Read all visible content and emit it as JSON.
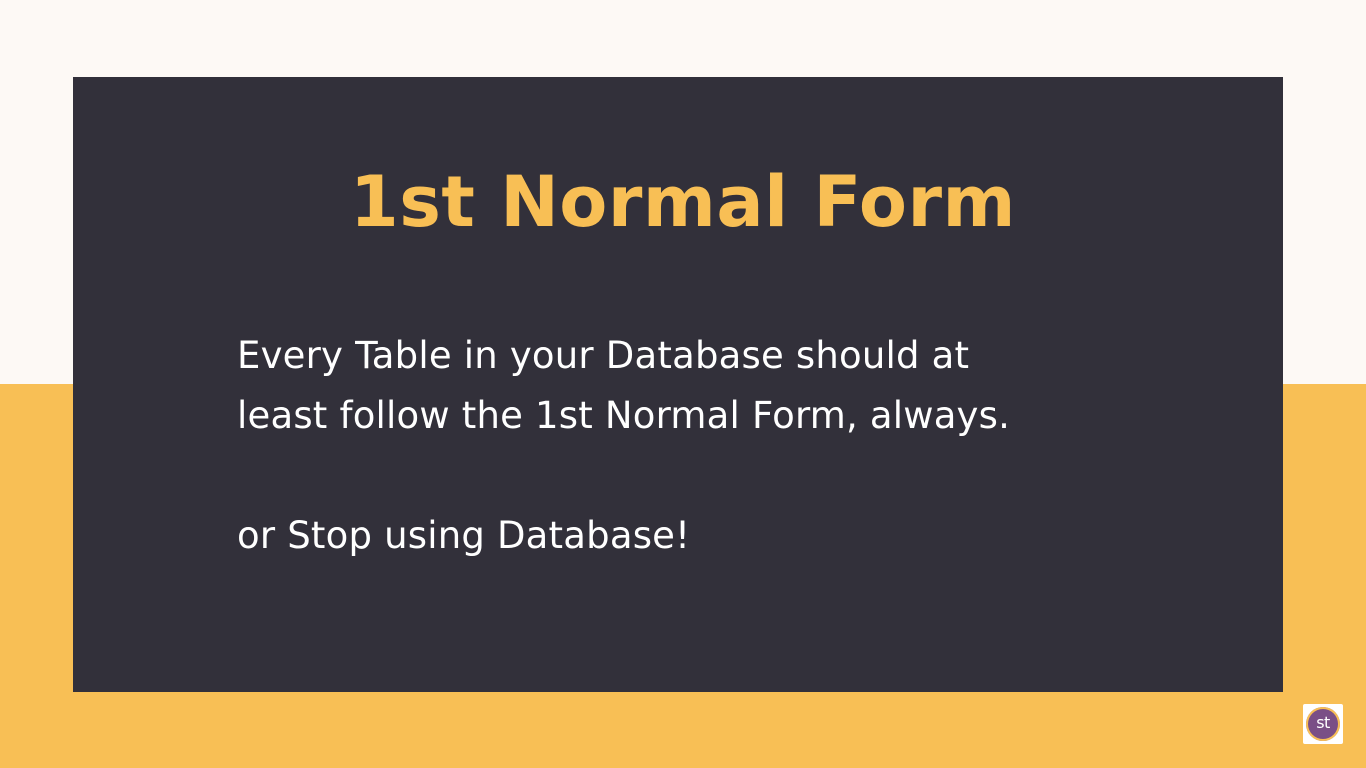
{
  "slide": {
    "title": "1st Normal Form",
    "body_lines": [
      "Every Table in your Database should at",
      "least follow the 1st Normal Form, always.",
      "or Stop using Database!"
    ]
  },
  "logo": {
    "text": "st",
    "icon": "studytonight-logo-icon"
  },
  "colors": {
    "accent": "#f8bf55",
    "card": "#32303a",
    "background_top": "#fdf9f5",
    "background_bottom": "#f8bf55",
    "logo_circle": "#7a4f86",
    "text": "#ffffff"
  }
}
